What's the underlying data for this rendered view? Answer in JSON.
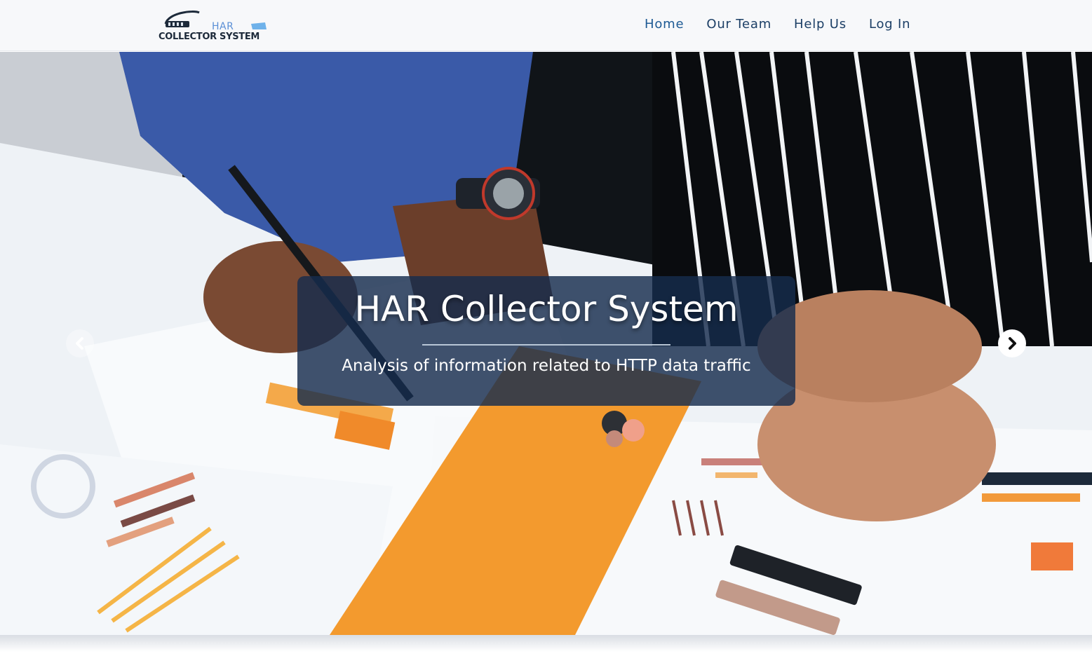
{
  "brand": {
    "logo_line1": "HAR",
    "logo_line2": "COLLECTOR SYSTEM"
  },
  "nav": {
    "items": [
      {
        "label": "Home",
        "active": true
      },
      {
        "label": "Our Team",
        "active": false
      },
      {
        "label": "Help Us",
        "active": false
      },
      {
        "label": "Log In",
        "active": false
      }
    ]
  },
  "hero": {
    "title": "HAR Collector System",
    "subtitle": "Analysis of information related to HTTP data traffic",
    "prev_icon": "chevron-left-icon",
    "next_icon": "chevron-right-icon"
  },
  "colors": {
    "nav_text": "#1c3f66",
    "caption_bg": "#162c4d",
    "accent_orange": "#f2a33a"
  }
}
